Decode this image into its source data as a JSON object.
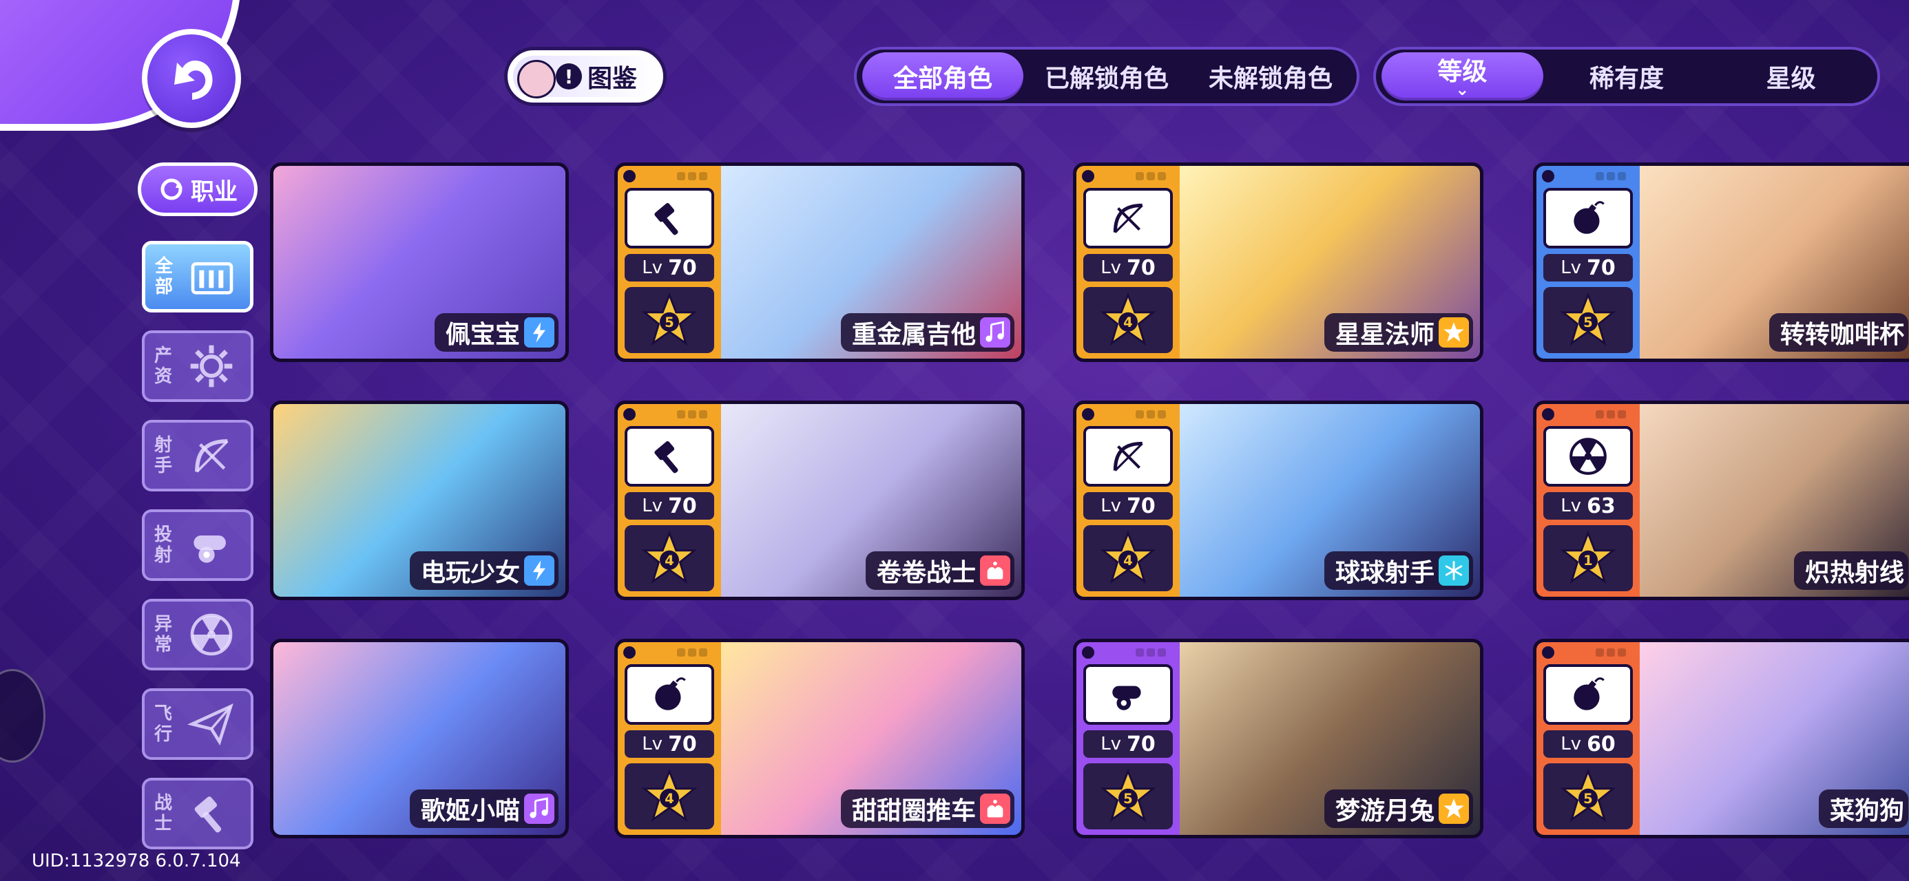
{
  "header": {
    "codex_label": "图鉴",
    "filter_tabs": [
      "全部角色",
      "已解锁角色",
      "未解锁角色"
    ],
    "active_filter": 0,
    "sort_tabs": [
      "等级",
      "稀有度",
      "星级"
    ],
    "active_sort": 0
  },
  "sidebar": {
    "job_label": "职业",
    "items": [
      {
        "label": "全部",
        "icon": "all-icon",
        "active": true
      },
      {
        "label": "产资",
        "icon": "sun-gear-icon",
        "active": false
      },
      {
        "label": "射手",
        "icon": "bow-icon",
        "active": false
      },
      {
        "label": "投射",
        "icon": "cannon-icon",
        "active": false
      },
      {
        "label": "异常",
        "icon": "radiation-icon",
        "active": false
      },
      {
        "label": "飞行",
        "icon": "paper-plane-icon",
        "active": false
      },
      {
        "label": "战士",
        "icon": "hammer-icon",
        "active": false
      }
    ]
  },
  "footer": {
    "uid": "UID:1132978 6.0.7.104"
  },
  "lv_prefix": "Lv",
  "colors": {
    "accent": "#7a3ff0",
    "background": "#3d1a85",
    "orange": "#f5a526",
    "blue": "#4a86ee",
    "purple": "#9a4ff0",
    "red": "#f26a3a",
    "gold": "#f2c33a"
  },
  "cards": [
    {
      "name": "佩宝宝",
      "type": "lightning-icon",
      "level": "",
      "stars": "",
      "class_icon": "",
      "frame": ""
    },
    {
      "name": "重金属吉他",
      "type": "music-note-icon",
      "level": "70",
      "stars": "5",
      "class_icon": "hammer-icon",
      "frame": "orange"
    },
    {
      "name": "星星法师",
      "type": "star-icon",
      "level": "70",
      "stars": "4",
      "class_icon": "bow-icon",
      "frame": "orange"
    },
    {
      "name": "转转咖啡杯",
      "type": "",
      "level": "70",
      "stars": "5",
      "class_icon": "bomb-icon",
      "frame": "blue"
    },
    {
      "name": "电玩少女",
      "type": "lightning-icon",
      "level": "",
      "stars": "",
      "class_icon": "",
      "frame": ""
    },
    {
      "name": "卷卷战士",
      "type": "cake-icon",
      "level": "70",
      "stars": "4",
      "class_icon": "hammer-icon",
      "frame": "orange"
    },
    {
      "name": "球球射手",
      "type": "snowflake-icon",
      "level": "70",
      "stars": "4",
      "class_icon": "bow-icon",
      "frame": "orange"
    },
    {
      "name": "炽热射线",
      "type": "",
      "level": "63",
      "stars": "1",
      "class_icon": "radiation-icon",
      "frame": "red"
    },
    {
      "name": "歌姬小喵",
      "type": "music-note-icon",
      "level": "",
      "stars": "",
      "class_icon": "",
      "frame": ""
    },
    {
      "name": "甜甜圈推车",
      "type": "cake-icon",
      "level": "70",
      "stars": "4",
      "class_icon": "bomb-icon",
      "frame": "orange"
    },
    {
      "name": "梦游月兔",
      "type": "star-icon",
      "level": "70",
      "stars": "5",
      "class_icon": "cannon-icon",
      "frame": "purple"
    },
    {
      "name": "菜狗狗",
      "type": "",
      "level": "60",
      "stars": "5",
      "class_icon": "bomb-icon",
      "frame": "red"
    }
  ]
}
